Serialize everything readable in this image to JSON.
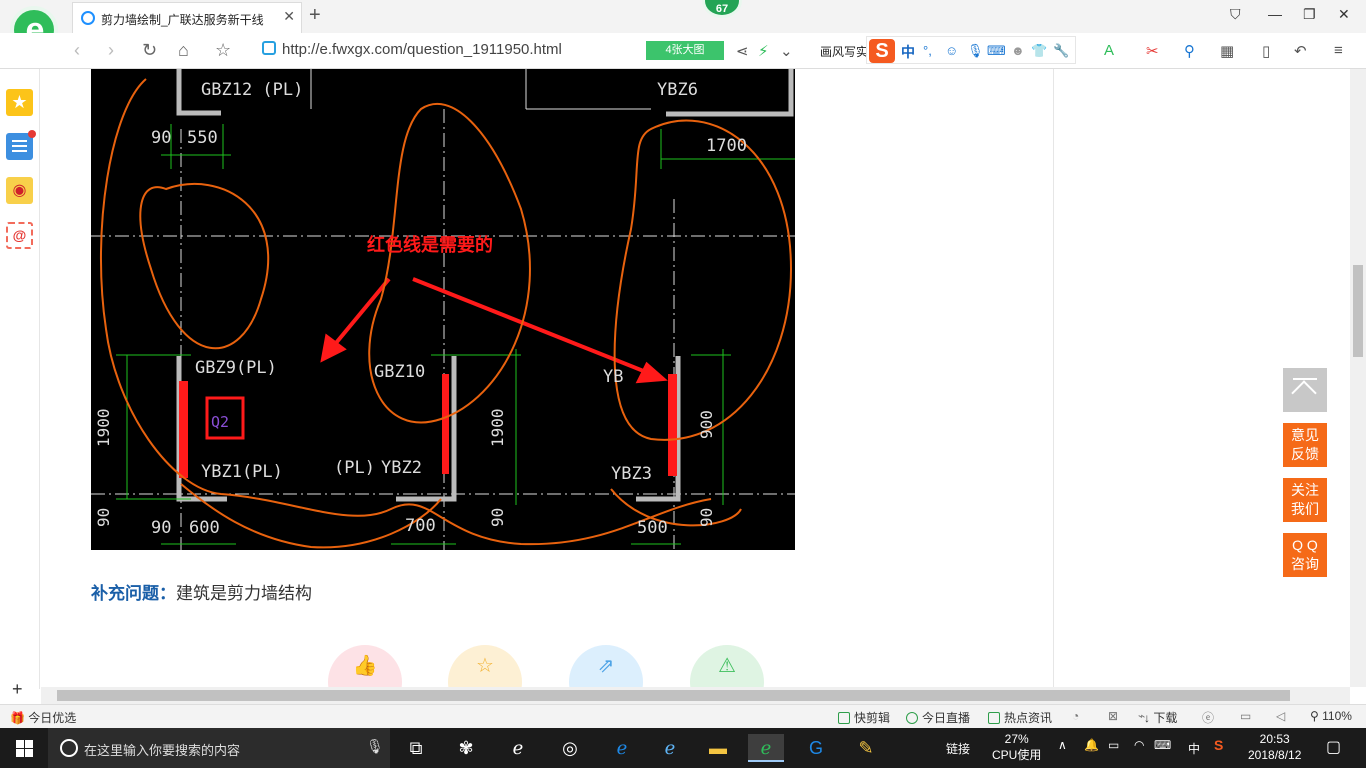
{
  "browser": {
    "tab_title": "剪力墙绘制_广联达服务新干线",
    "badge_count": "67",
    "url": "http://e.fwxgx.com/question_1911950.html",
    "images_button": "4张大图",
    "search_engine_label": "画风写实",
    "ime_label": "中"
  },
  "drawing": {
    "annotation": "红色线是需要的",
    "labels": {
      "gbz12": "GBZ12 (PL)",
      "ybz6": "YBZ6",
      "gbz9": "GBZ9(PL)",
      "gbz10": "GBZ10",
      "yb": "YB",
      "ybz1": "YBZ1(PL)",
      "pl": "(PL)",
      "ybz2": "YBZ2",
      "ybz3": "YBZ3",
      "q2": "Q2"
    },
    "dimensions": {
      "d90a": "90",
      "d550": "550",
      "d1700": "1700",
      "d1900a": "1900",
      "d1900b": "1900",
      "d900": "900",
      "d90b": "90",
      "d90c": "90",
      "d600": "600",
      "d700": "700",
      "d90d": "90",
      "d500": "500",
      "d90e": "90"
    }
  },
  "question": {
    "supplement_label": "补充问题：",
    "supplement_text": "建筑是剪力墙结构"
  },
  "float_buttons": {
    "feedback_line1": "意见",
    "feedback_line2": "反馈",
    "follow_line1": "关注",
    "follow_line2": "我们",
    "qq_line1": "Q Q",
    "qq_line2": "咨询"
  },
  "statusbar": {
    "today_pick": "今日优选",
    "quick_clip": "快剪辑",
    "today_live": "今日直播",
    "hot_news": "热点资讯",
    "download": "下载",
    "zoom": "110%"
  },
  "taskbar": {
    "search_placeholder": "在这里输入你要搜索的内容",
    "link_label": "链接",
    "cpu_percent": "27%",
    "cpu_label": "CPU使用",
    "ime": "中",
    "time": "20:53",
    "date": "2018/8/12"
  },
  "colors": {
    "accent_green": "#2fbd5a",
    "orange_button": "#f56a18",
    "annotation_red": "#ff1a1a",
    "freehand_orange": "#e8620e",
    "link_blue": "#1a5fa8"
  }
}
